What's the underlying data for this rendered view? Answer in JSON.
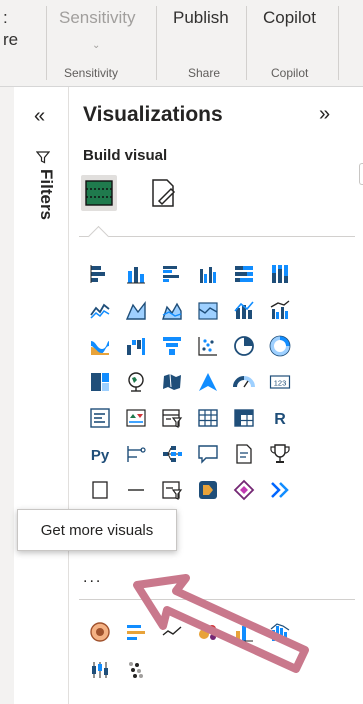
{
  "ribbon": {
    "partial_left_top": ":",
    "partial_left_bottom": "re",
    "sensitivity_top": "Sensitivity",
    "sensitivity_label": "Sensitivity",
    "publish_top": "Publish",
    "share_label": "Share",
    "copilot_top": "Copilot",
    "copilot_label": "Copilot"
  },
  "filters_pane": {
    "collapse_glyph": "«",
    "label": "Filters"
  },
  "viz_pane": {
    "title": "Visualizations",
    "expand_glyph": "»",
    "build_label": "Build visual",
    "more_dots": "...",
    "tooltip": "Get more visuals",
    "r_label": "R",
    "py_label": "Py",
    "card_label": "123"
  },
  "colors": {
    "accent_blue": "#118dff",
    "dark_blue": "#1f4e79",
    "arrow_pink": "#c9788c",
    "build_tab_green": "#1f7a4d"
  }
}
